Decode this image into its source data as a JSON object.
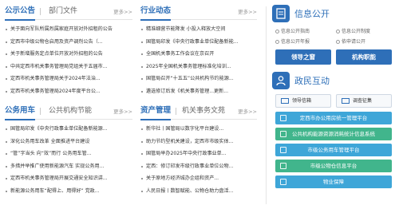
{
  "panels": {
    "tl": {
      "tab_active": "公示公告",
      "tab_inactive": "部门文件",
      "more": "更多>>",
      "items": [
        "关于面向军队所属烈属家庭开放对外招租的公告",
        "定西市中级公物仓启用及资产调剂公告（...",
        "关于新增服务定点单位开放对外招租的公告",
        "中共定西市机关事务管理局党组关于五届市...",
        "定西市机关事务管理局关于2024年法治...",
        "定西市机关事务管理局2024年度平台公..."
      ]
    },
    "tr": {
      "tab_active": "行业动态",
      "more": "更多>>",
      "items": [
        "精准细营节能降发 小投入释放大空间",
        "国管局印发《中央行政事业单位配备新能...",
        "全国机关事务工作会议在京召开",
        "2025年全国机关事务管理标准化培训...",
        "国管局召开“十五五”公共机构节约能源...",
        "遴选修订后发《机关事务管理...更新..."
      ]
    },
    "bl": {
      "tab_active": "公务用车",
      "tab_inactive": "公共机构节能",
      "more": "更多>>",
      "items": [
        "国管局印发《中央行政事业单位配备新能源...",
        "深化公务用车改革 全面推进平台建设",
        "“管”字当头 向“效”而行 公务用车管...",
        "多措并举推广使用新能源汽车 实现公务用...",
        "定西市机关事务管理局开展交通安全知识讲...",
        "新能源公务用车“配得上、用得好” 党政..."
      ]
    },
    "br": {
      "tab_active": "资产管理",
      "tab_inactive": "机关事务文苑",
      "more": "更多>>",
      "items": [
        "新华社丨国管局以数字化平台建设...",
        "助力节约型机关建设，定西市市级实体...",
        "国管局举办2025年中央行政事业单...",
        "定西：修订印发市级行政事业单位公物...",
        "关于原地方经济城办企组和资产...",
        "人民日报丨数智赋能、公物仓助力盘活..."
      ]
    }
  },
  "info": {
    "title": "信息公开",
    "links": [
      "信息公开指南",
      "信息公开制度",
      "信息公开年报",
      "依申请公开"
    ],
    "btn_leaders": "领导之窗",
    "btn_functions": "机构职能"
  },
  "interact": {
    "title": "政民互动",
    "mailbox": "领导信箱",
    "survey": "调查征集"
  },
  "services": [
    {
      "label": "定西市办公用房统一管理平台",
      "color": "#3ea6d8"
    },
    {
      "label": "公共机构能源资源消耗统计信息系统",
      "color": "#41b58c"
    },
    {
      "label": "市级公务用车管理平台",
      "color": "#3ea6d8"
    },
    {
      "label": "市级公物仓信息平台",
      "color": "#41b58c"
    },
    {
      "label": "物业保障",
      "color": "#3ea6d8"
    }
  ],
  "colors": {
    "accent": "#2e6fb8",
    "teal": "#3ea6d8",
    "green": "#41b58c"
  }
}
